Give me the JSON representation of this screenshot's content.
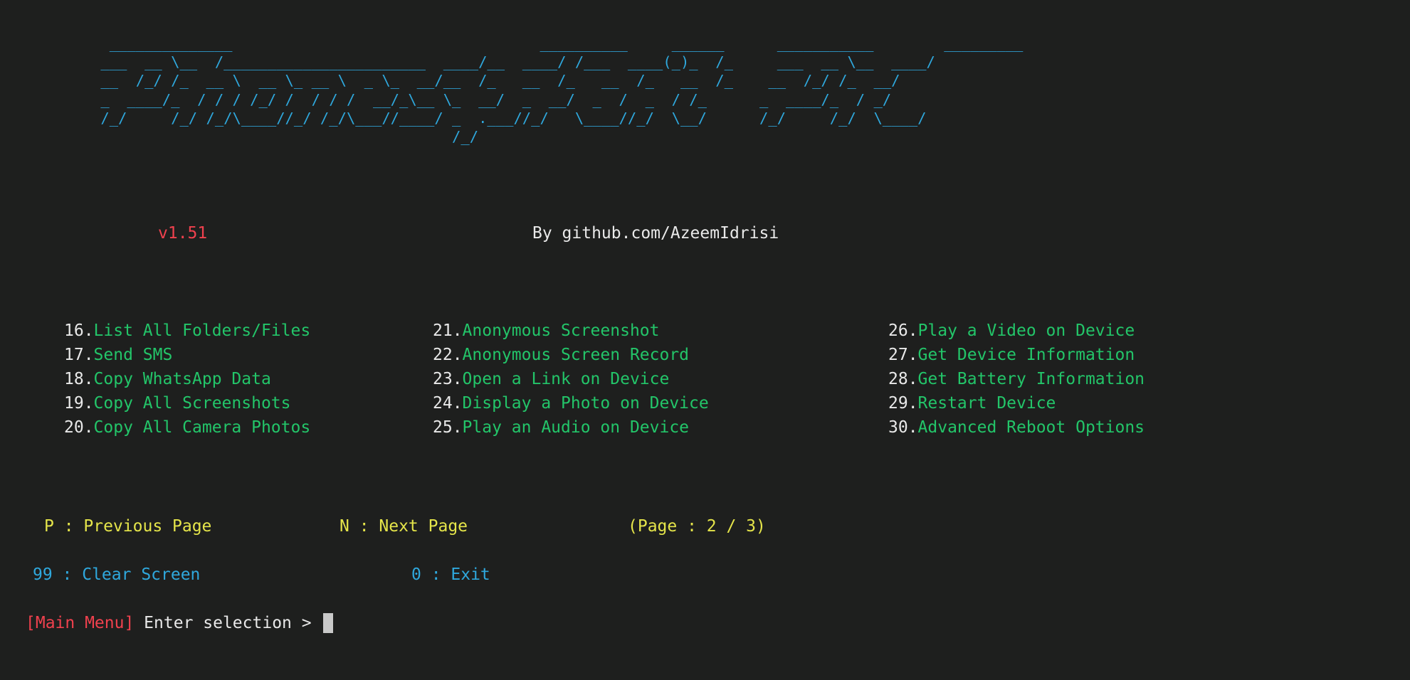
{
  "window": {
    "title": "PhoneSploit Pro",
    "background_color": "#1e1f1e"
  },
  "colors": {
    "banner_blue": "#2fa8dd",
    "menu_green": "#23c569",
    "menu_number_white": "#e9e9e9",
    "nav_yellow": "#e5e54a",
    "util_cyan": "#2fa8dd",
    "accent_red": "#f0414e",
    "cursor_gray": "#c9c9c9"
  },
  "banner": {
    "art": "     ______________                                   __________     ______      ___________        _________\n    ___  __ \\__  /_______________________  ____/__  ____/ /___  ____(_)_  /_     ___  __ \\__  ____/\n    __  /_/ /_  __ \\  __ \\_ __ \\  _ \\_  __/__  /_   __  /_   __  /_   __  /_    __  /_/ /_  __/\n    _  ____/_  / / / /_/ /  / / /  __/_\\__ \\_  __/  _  __/  _  /  _  / /_      _  ____/_  / _/\n    /_/     /_/ /_/\\____//_/ /_/\\___//____/ _  .___//_/   \\____//_/  \\__/      /_/     /_/  \\____/\n                                            /_/",
    "ascii_name": "PhoneSploit Pro"
  },
  "header": {
    "version": "v1.51",
    "author": "By github.com/AzeemIdrisi"
  },
  "menu": {
    "columns": [
      {
        "items": [
          {
            "number": "16.",
            "label": "List All Folders/Files"
          },
          {
            "number": "17.",
            "label": "Send SMS"
          },
          {
            "number": "18.",
            "label": "Copy WhatsApp Data"
          },
          {
            "number": "19.",
            "label": "Copy All Screenshots"
          },
          {
            "number": "20.",
            "label": "Copy All Camera Photos"
          }
        ]
      },
      {
        "items": [
          {
            "number": "21.",
            "label": "Anonymous Screenshot"
          },
          {
            "number": "22.",
            "label": "Anonymous Screen Record"
          },
          {
            "number": "23.",
            "label": "Open a Link on Device"
          },
          {
            "number": "24.",
            "label": "Display a Photo on Device"
          },
          {
            "number": "25.",
            "label": "Play an Audio on Device"
          }
        ]
      },
      {
        "items": [
          {
            "number": "26.",
            "label": "Play a Video on Device"
          },
          {
            "number": "27.",
            "label": "Get Device Information"
          },
          {
            "number": "28.",
            "label": "Get Battery Information"
          },
          {
            "number": "29.",
            "label": "Restart Device"
          },
          {
            "number": "30.",
            "label": "Advanced Reboot Options"
          }
        ]
      }
    ]
  },
  "navigation": {
    "previous_page": "P : Previous Page",
    "next_page": "N : Next Page",
    "page_indicator": "(Page : 2 / 3)",
    "current_page": 2,
    "total_pages": 3
  },
  "utilities": {
    "clear_screen": "99 : Clear Screen",
    "exit": "0 : Exit"
  },
  "prompt": {
    "context": "[Main Menu]",
    "text": " Enter selection > ",
    "input_value": ""
  }
}
